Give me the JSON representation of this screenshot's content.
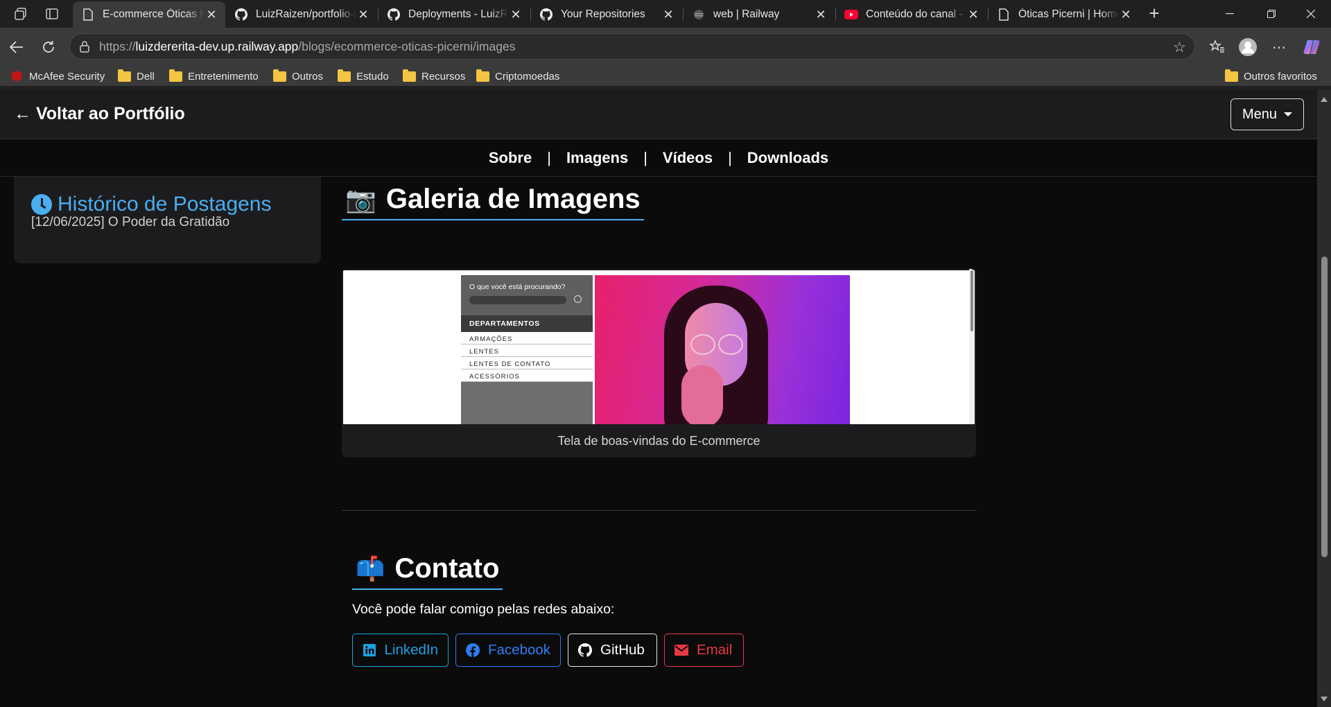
{
  "browser": {
    "tabs": [
      {
        "title": "E-commerce Óticas Picerni",
        "favicon": "page-icon",
        "active": true
      },
      {
        "title": "LuizRaizen/portfolio-luiz",
        "favicon": "github-icon",
        "active": false
      },
      {
        "title": "Deployments - LuizRaizen",
        "favicon": "github-icon",
        "active": false
      },
      {
        "title": "Your Repositories",
        "favicon": "github-icon",
        "active": false
      },
      {
        "title": "web | Railway",
        "favicon": "railway-icon",
        "active": false
      },
      {
        "title": "Conteúdo do canal - YouTube",
        "favicon": "youtube-icon",
        "active": false
      },
      {
        "title": "Óticas Picerni | Home",
        "favicon": "page-icon",
        "active": false
      }
    ],
    "url_prefix": "https://",
    "url_host": "luizdererita-dev.up.railway.app",
    "url_path": "/blogs/ecommerce-oticas-picerni/images",
    "bookmarks": [
      "McAfee Security",
      "Dell",
      "Entretenimento",
      "Outros",
      "Estudo",
      "Recursos",
      "Criptomoedas"
    ],
    "other_favorites": "Outros favoritos"
  },
  "page": {
    "back_link": "← Voltar ao Portfólio",
    "menu_label": "Menu",
    "section_nav": [
      "Sobre",
      "Imagens",
      "Vídeos",
      "Downloads"
    ],
    "sidebar": {
      "title": "Histórico de Postagens",
      "posts": [
        "[12/06/2025] O Poder da Gratidão"
      ]
    },
    "gallery": {
      "title": "Galeria de Imagens",
      "emoji": "📷",
      "items": [
        {
          "caption": "Tela de boas-vindas do E-commerce",
          "screenshot": {
            "search_prompt": "O que você está procurando?",
            "departments_header": "DEPARTAMENTOS",
            "departments": [
              "ARMAÇÕES",
              "LENTES",
              "LENTES DE CONTATO",
              "ACESSÓRIOS"
            ]
          }
        }
      ]
    },
    "contact": {
      "title": "Contato",
      "emoji": "📫",
      "text": "Você pode falar comigo pelas redes abaixo:",
      "buttons": [
        {
          "label": "LinkedIn",
          "icon": "linkedin-icon",
          "color": "#1ba1e2"
        },
        {
          "label": "Facebook",
          "icon": "facebook-icon",
          "color": "#2d7df5"
        },
        {
          "label": "GitHub",
          "icon": "github-icon",
          "color": "#ffffff"
        },
        {
          "label": "Email",
          "icon": "envelope-icon",
          "color": "#e63946"
        }
      ]
    },
    "accent_color": "#4aaef0"
  }
}
